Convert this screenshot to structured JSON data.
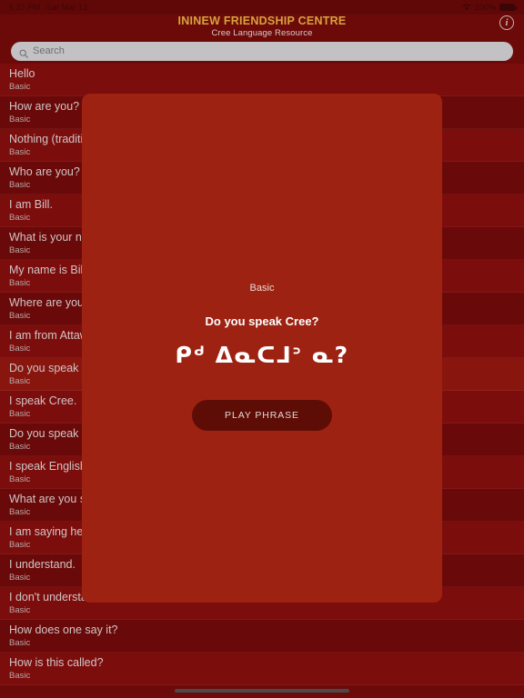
{
  "status_bar": {
    "time": "6:27 PM",
    "date": "Sat Mar 13",
    "wifi_icon": "wifi-icon",
    "battery_percent": "100%",
    "battery_icon": "battery-full-icon"
  },
  "header": {
    "title": "ININEW FRIENDSHIP CENTRE",
    "subtitle": "Cree Language Resource",
    "info_icon": "info-circle-icon",
    "info_label": "i"
  },
  "search": {
    "placeholder": "Search",
    "value": "",
    "icon": "search-icon"
  },
  "list": {
    "items": [
      {
        "title": "Hello",
        "category": "Basic"
      },
      {
        "title": "How are you?",
        "category": "Basic"
      },
      {
        "title": "Nothing (traditional reply)",
        "category": "Basic"
      },
      {
        "title": "Who are you?",
        "category": "Basic"
      },
      {
        "title": "I am Bill.",
        "category": "Basic"
      },
      {
        "title": "What is your name?",
        "category": "Basic"
      },
      {
        "title": "My name is Bill.",
        "category": "Basic"
      },
      {
        "title": "Where are you from?",
        "category": "Basic"
      },
      {
        "title": "I am from Attawapiskat.",
        "category": "Basic"
      },
      {
        "title": "Do you speak Cree?",
        "category": "Basic",
        "selected": true
      },
      {
        "title": "I speak Cree.",
        "category": "Basic"
      },
      {
        "title": "Do you speak English?",
        "category": "Basic"
      },
      {
        "title": "I speak English.",
        "category": "Basic"
      },
      {
        "title": "What are you saying?",
        "category": "Basic"
      },
      {
        "title": "I am saying hello.",
        "category": "Basic"
      },
      {
        "title": "I understand.",
        "category": "Basic"
      },
      {
        "title": "I don't understand.",
        "category": "Basic"
      },
      {
        "title": "How does one say it?",
        "category": "Basic"
      },
      {
        "title": "How is this called?",
        "category": "Basic"
      }
    ]
  },
  "modal": {
    "category": "Basic",
    "english": "Do you speak Cree?",
    "syllabics": "ᑭᒄ ᐃᓇᑕᒧᐣ ᓇ?",
    "play_label": "PLAY PHRASE"
  },
  "home_indicator": "home-indicator",
  "colors": {
    "app_background": "#7d0c0c",
    "row_background": "#8f1010",
    "row_background_alt": "#7a0b0b",
    "row_selected": "#9e1b13",
    "modal_background": "#9e2212",
    "brand_gold": "#d8a23c",
    "play_button": "#5e0d06",
    "search_field": "#c3c1c4"
  }
}
